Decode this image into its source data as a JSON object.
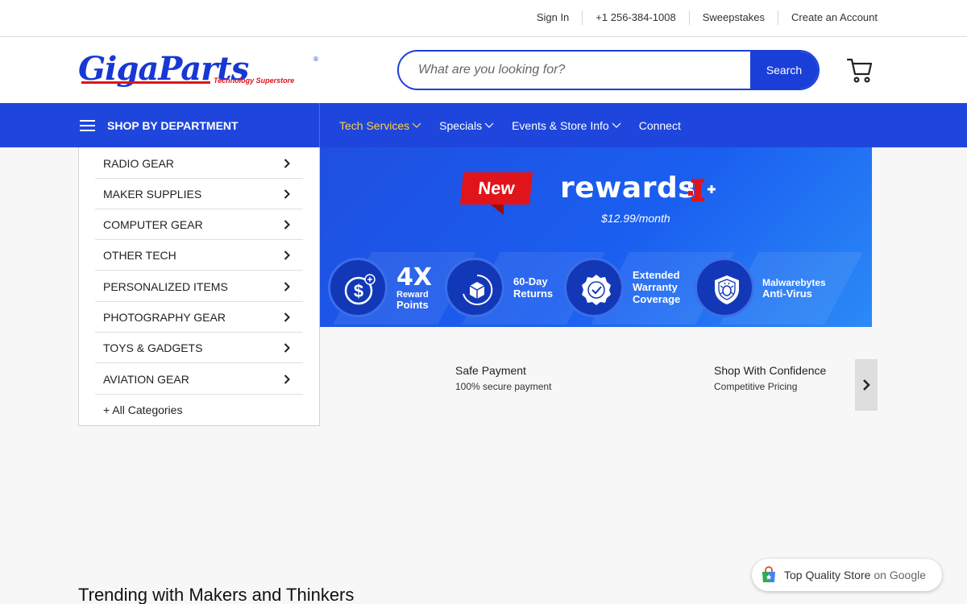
{
  "topbar": {
    "sign_in": "Sign In",
    "phone": "+1 256-384-1008",
    "sweepstakes": "Sweepstakes",
    "create_account": "Create an Account"
  },
  "header": {
    "logo_text": "GigaParts",
    "logo_tagline": "Technology Superstore",
    "search_placeholder": "What are you looking for?",
    "search_button": "Search",
    "cart_icon": "cart-icon"
  },
  "nav": {
    "department_label": "SHOP BY DEPARTMENT",
    "menu": [
      {
        "label": "Tech Services",
        "dropdown": true,
        "active": true
      },
      {
        "label": "Specials",
        "dropdown": true,
        "active": false
      },
      {
        "label": "Events & Store Info",
        "dropdown": true,
        "active": false
      },
      {
        "label": "Connect",
        "dropdown": false,
        "active": false
      }
    ]
  },
  "departments": [
    "RADIO GEAR",
    "MAKER SUPPLIES",
    "COMPUTER GEAR",
    "OTHER TECH",
    "PERSONALIZED ITEMS",
    "PHOTOGRAPHY GEAR",
    "TOYS & GADGETS",
    "AVIATION GEAR"
  ],
  "all_categories": "+ All Categories",
  "banner": {
    "new_tag": "New",
    "title": "rewards",
    "price": "$12.99/month",
    "perks": {
      "reward_big": "4X",
      "reward_line1": "Reward",
      "reward_line2": "Points",
      "returns_line1": "60-Day",
      "returns_line2": "Returns",
      "warranty_line1": "Extended",
      "warranty_line2": "Warranty",
      "warranty_line3": "Coverage",
      "antivirus_line1": "Malwarebytes",
      "antivirus_line2": "Anti-Virus"
    }
  },
  "trust": {
    "payment_title": "Safe Payment",
    "payment_sub": "100% secure payment",
    "confidence_title": "Shop With Confidence",
    "confidence_sub": "Competitive Pricing"
  },
  "trending_heading": "Trending with Makers and Thinkers",
  "google_badge": {
    "main": "Top Quality Store",
    "suffix": "on Google"
  },
  "colors": {
    "brand_blue": "#1f46dc",
    "accent_yellow": "#ffcf3f",
    "brand_red": "#e0141e"
  }
}
